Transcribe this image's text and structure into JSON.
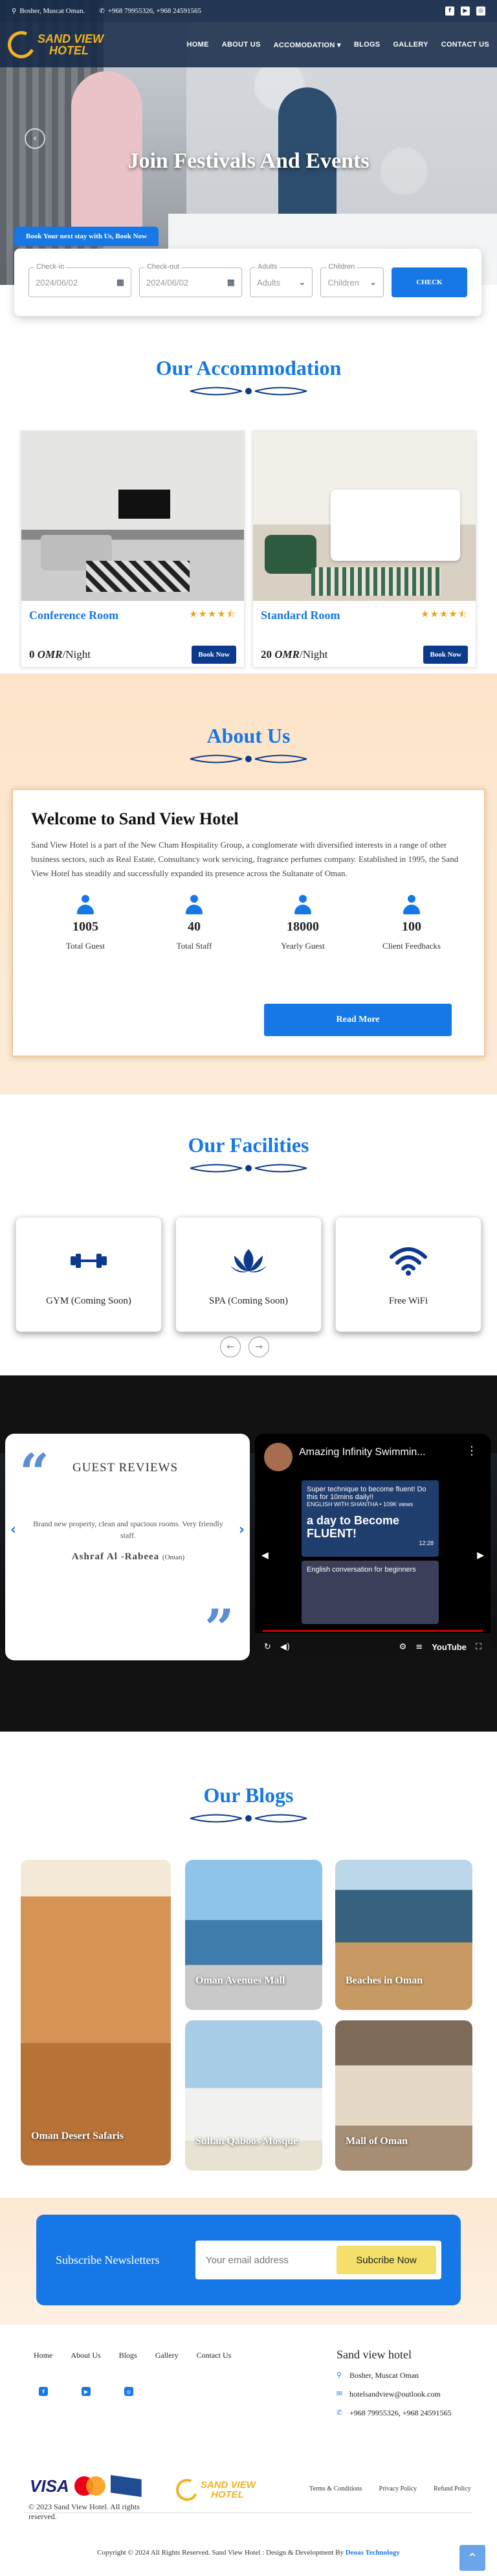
{
  "topbar": {
    "location": "Bosher, Muscat Oman.",
    "phones": "+968 79955326, +968 24591565"
  },
  "brand": {
    "line1": "SAND VIEW",
    "line2": "HOTEL"
  },
  "nav": [
    "HOME",
    "ABOUT US",
    "ACCOMODATION ▾",
    "BLOGS",
    "GALLERY",
    "CONTACT US"
  ],
  "hero": {
    "heading": "Join Festivals And Events",
    "tag": "Book Your next stay with Us, Book Now"
  },
  "booking": {
    "checkin_label": "Check-in",
    "checkin_value": "2024/06/02",
    "checkout_label": "Check-out",
    "checkout_value": "2024/06/02",
    "adults_label": "Adults",
    "adults_value": "Adults",
    "children_label": "Children",
    "children_value": "Children",
    "button": "CHECK"
  },
  "accommodation": {
    "title": "Our Accommodation",
    "rooms": [
      {
        "name": "Conference Room",
        "rating": 4.5,
        "price": "0",
        "currency": "OMR",
        "per": "/Night",
        "button": "Book Now"
      },
      {
        "name": "Standard Room",
        "rating": 4.5,
        "price": "20",
        "currency": "OMR",
        "per": "/Night",
        "button": "Book Now"
      }
    ]
  },
  "about": {
    "title": "About Us",
    "heading": "Welcome to Sand View Hotel",
    "text": "Sand View Hotel is a part of the New Cham Hospitality Group, a conglomerate with diversified interests in a range of other business sectors, such as Real Estate, Consultancy work servicing, fragrance perfumes company. Established in 1995, the Sand View Hotel has steadily and successfully expanded its presence across the Sultanate of Oman.",
    "stats": [
      {
        "number": "1005",
        "label": "Total Guest"
      },
      {
        "number": "40",
        "label": "Total Staff"
      },
      {
        "number": "18000",
        "label": "Yearly Guest"
      },
      {
        "number": "100",
        "label": "Client Feedbacks"
      }
    ],
    "button": "Read More"
  },
  "facilities": {
    "title": "Our Facilities",
    "items": [
      {
        "label": "GYM (Coming Soon)",
        "icon": "dumbbell-icon"
      },
      {
        "label": "SPA (Coming Soon)",
        "icon": "lotus-icon"
      },
      {
        "label": "Free WiFi",
        "icon": "wifi-icon"
      }
    ]
  },
  "reviews": {
    "title": "GUEST REVIEWS",
    "text": "Brand new property, clean and spacious rooms. Very friendly staff.",
    "author": "Ashraf Al -Rabeea",
    "author_location": "(Oman)"
  },
  "video": {
    "title": "Amazing Infinity Swimmin...",
    "thumb1_line1": "Super technique to become fluent! Do this for 10mins daily!!",
    "thumb1_line2": "ENGLISH WITH SHANTHA • 109K views",
    "thumb1_big": "a day to Become FLUENT!",
    "thumb1_time": "12:28",
    "thumb2_line": "English conversation for beginners",
    "player": "YouTube"
  },
  "blogs": {
    "title": "Our Blogs",
    "items": [
      {
        "caption": "Oman Desert Safaris"
      },
      {
        "caption": "Oman Avenues Mall"
      },
      {
        "caption": "Beaches in Oman"
      },
      {
        "caption": "Sultan Qaboos Mosque"
      },
      {
        "caption": "Mall of Oman"
      }
    ]
  },
  "newsletter": {
    "label": "Subscribe Newsletters",
    "placeholder": "Your email address",
    "button": "Subcribe Now"
  },
  "footer": {
    "links": [
      "Home",
      "About Us",
      "Blogs",
      "Gallery",
      "Contact Us"
    ],
    "contact_title": "Sand view hotel",
    "address": "Bosher, Muscat Oman",
    "email": "hotelsandview@outlook.com",
    "phones": "+968 79955326, +968 24591565",
    "copyright1": "© 2023 Sand View Hotel. All rights reserved.",
    "legal": [
      "Terms & Conditions",
      "Privacy Policy",
      "Refund Policy"
    ],
    "copyright2": "Copyright © 2024 All Rights Reserved. Sand View Hotel : Design & Development By",
    "developer": "Deoas Technology",
    "card_visa": "VISA"
  },
  "colors": {
    "accent": "#1678e6",
    "brand_gold": "#f0b323",
    "navy": "#0b3a8c",
    "cream": "#fde4c9"
  }
}
